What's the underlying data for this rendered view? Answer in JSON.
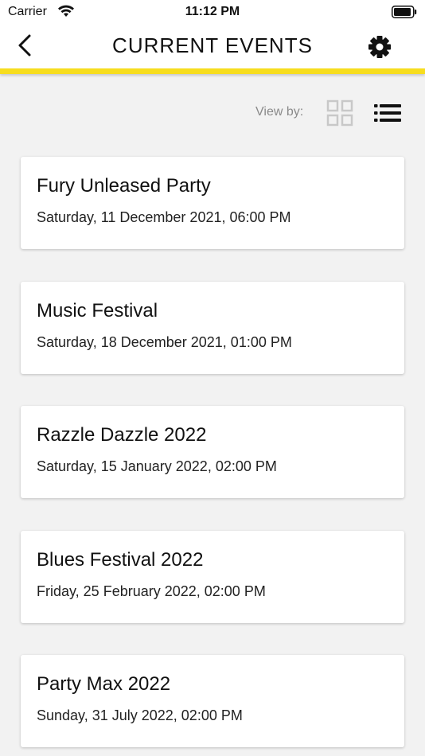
{
  "status_bar": {
    "carrier": "Carrier",
    "time": "11:12 PM"
  },
  "header": {
    "title": "CURRENT EVENTS",
    "back_icon": "chevron-left-icon",
    "settings_icon": "gear-icon",
    "accent_color": "#f7dd1e"
  },
  "view_toggle": {
    "label": "View by:",
    "options": [
      {
        "icon": "grid-view-icon",
        "selected": false
      },
      {
        "icon": "list-view-icon",
        "selected": true
      }
    ]
  },
  "events": [
    {
      "title": "Fury Unleased Party",
      "date": "Saturday, 11 December 2021, 06:00 PM"
    },
    {
      "title": "Music Festival",
      "date": "Saturday, 18 December 2021, 01:00 PM"
    },
    {
      "title": "Razzle Dazzle 2022",
      "date": "Saturday, 15 January 2022, 02:00 PM"
    },
    {
      "title": "Blues Festival 2022",
      "date": "Friday, 25 February 2022, 02:00 PM"
    },
    {
      "title": "Party Max 2022",
      "date": "Sunday, 31 July 2022, 02:00 PM"
    }
  ]
}
